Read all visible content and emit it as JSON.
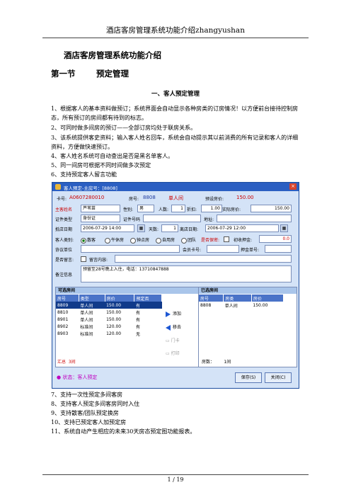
{
  "header": "酒店客房管理系统功能介绍zhangyushan",
  "doc_title": "酒店客房管理系统功能介绍",
  "section": {
    "number": "第一节",
    "title": "预定管理"
  },
  "subsection": "一、客人预定管理",
  "list_top": [
    "1、根据客人的基本资料做预订；系统界面会自动显示各种房类的订房情况！以方便前台接待控制房态，所有预订的房间都有待到的标志。",
    "2、可同时做多间房的预订——全部订房均处于联房关系。",
    "3、该系统提供客史资料；输入客人姓名回车，系统会自动提示其以前消费的所有记录和客人的详细资料，方便做快速预订。",
    "4、客人姓名系统可自动查出是否是黑名单客人。",
    "5、同一间房可根据不同时间做多次预定",
    "6、支持预定客人留言功能"
  ],
  "dialog": {
    "title": "客人预定-主房号：[8808]",
    "card_label": "卡号:",
    "card_no": "A0607280010",
    "room_label": "房号:",
    "room_no": "8808",
    "room_type": "单人间",
    "price_label": "预设房价:",
    "price": "150.00",
    "name_label": "主客姓名",
    "name_value": "芦苇苗",
    "gender_label": "性别:",
    "gender_value": "男",
    "count_label": "人数:",
    "count_value": "1",
    "discount_label": "折扣:",
    "discount_value": "1.00",
    "actual_label": "实际房价:",
    "actual_value": "150.00",
    "id_type_label": "证件类型",
    "id_type_value": "身份证",
    "id_no_label": "证件号码",
    "address_label": "地址:",
    "arrive_label": "抵店日期",
    "arrive_value": "2006-07-29 14:00",
    "days_label": "天数:",
    "days_value": "1",
    "leave_label": "离店日期:",
    "leave_value": "2006-07-29 12:00",
    "guest_cat_label": "客人类别:",
    "guest_cats": [
      "散客",
      "午休房",
      "钟点房",
      "自用房",
      "团队"
    ],
    "secret_label": "是否保密:",
    "deposit_label": "初收押金:",
    "deposit_value": "0.0",
    "agreement_label": "协议单位",
    "member_label": "会员卡号:",
    "deposit_no_label": "押金单号:",
    "msg_label": "是否留言:",
    "msg_content_label": "留言内容:",
    "remark_label": "备注信息",
    "remark_value": "预留至28号晚上入住，电话：13710847888",
    "available_title": "可选房间",
    "available_headers": [
      "房号",
      "类型",
      "房价",
      "预定否"
    ],
    "available_rows": [
      [
        "8809",
        "单人间",
        "150.00",
        "有"
      ],
      [
        "8810",
        "单人间",
        "150.00",
        "有"
      ],
      [
        "8901",
        "单人间",
        "150.00",
        "有"
      ],
      [
        "8902",
        "标准间",
        "120.00",
        "有"
      ],
      [
        "8903",
        "标准间",
        "120.00",
        "无"
      ]
    ],
    "total_label": "汇总",
    "total_value": "3间",
    "selected_title": "已选房间",
    "selected_headers": [
      "房号",
      "房类",
      "房价"
    ],
    "selected_rows": [
      [
        "8808",
        "单人间",
        "150.00"
      ]
    ],
    "rooms_label": "房数：",
    "rooms_value": "1间",
    "btn_add": "添加",
    "btn_remove": "移去",
    "btn_door": "门卡",
    "btn_print": "打印",
    "status_text": "状态：客人预定",
    "btn_save": "保存(S)",
    "btn_close": "关闭(C)"
  },
  "list_bottom": [
    "7、支持一次性预定多间客房",
    "8、支持客人预定多间客房同时入住",
    "9、支持散客/团队预定换房",
    "10、支持已预定客人加预定房",
    "11、系统自动产生相应的未来30天房态预定图功能报表。"
  ],
  "footer": "1 / 19"
}
